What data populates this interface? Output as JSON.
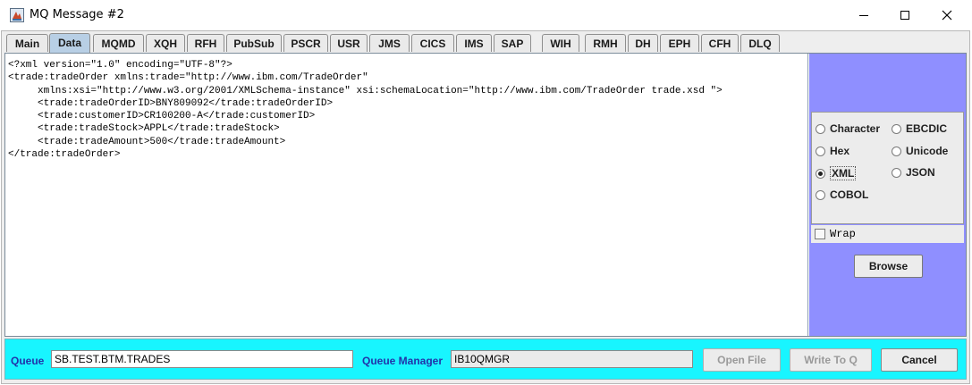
{
  "window": {
    "title": "MQ Message #2",
    "controls": [
      "minimize-icon",
      "maximize-icon",
      "close-icon"
    ]
  },
  "tabs": [
    {
      "label": "Main",
      "active": false
    },
    {
      "label": "Data",
      "active": true
    },
    {
      "label": "MQMD",
      "active": false
    },
    {
      "label": "XQH",
      "active": false
    },
    {
      "label": "RFH",
      "active": false
    },
    {
      "label": "PubSub",
      "active": false
    },
    {
      "label": "PSCR",
      "active": false
    },
    {
      "label": "USR",
      "active": false
    },
    {
      "label": "JMS",
      "active": false
    },
    {
      "label": "CICS",
      "active": false
    },
    {
      "label": "IMS",
      "active": false
    },
    {
      "label": "SAP",
      "active": false
    },
    {
      "label": "WIH",
      "active": false
    },
    {
      "label": "RMH",
      "active": false
    },
    {
      "label": "DH",
      "active": false
    },
    {
      "label": "EPH",
      "active": false
    },
    {
      "label": "CFH",
      "active": false
    },
    {
      "label": "DLQ",
      "active": false
    }
  ],
  "editor": {
    "lines": [
      "<?xml version=\"1.0\" encoding=\"UTF-8\"?>",
      "<trade:tradeOrder xmlns:trade=\"http://www.ibm.com/TradeOrder\"",
      "     xmlns:xsi=\"http://www.w3.org/2001/XMLSchema-instance\" xsi:schemaLocation=\"http://www.ibm.com/TradeOrder trade.xsd \">",
      "     <trade:tradeOrderID>BNY809092</trade:tradeOrderID>",
      "     <trade:customerID>CR100200-A</trade:customerID>",
      "     <trade:tradeStock>APPL</trade:tradeStock>",
      "     <trade:tradeAmount>500</trade:tradeAmount>",
      "</trade:tradeOrder>"
    ]
  },
  "format_options": {
    "character": "Character",
    "ebcdic": "EBCDIC",
    "hex": "Hex",
    "unicode": "Unicode",
    "xml": "XML",
    "json": "JSON",
    "cobol": "COBOL",
    "selected": "XML"
  },
  "wrap": {
    "label": "Wrap",
    "checked": false
  },
  "browse_label": "Browse",
  "bottom": {
    "queue_label": "Queue",
    "queue_value": "SB.TEST.BTM.TRADES",
    "qmgr_label": "Queue Manager",
    "qmgr_value": "IB10QMGR",
    "open_file_label": "Open File",
    "write_to_q_label": "Write To Q",
    "cancel_label": "Cancel"
  },
  "colors": {
    "active_tab": "#b8cfe5",
    "side_panel": "#8f8fff",
    "bottom_bar": "#18f5ff",
    "label_text": "#2233aa"
  }
}
